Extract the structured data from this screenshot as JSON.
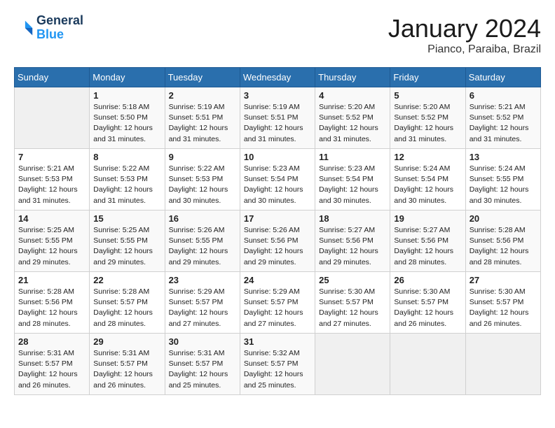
{
  "logo": {
    "line1": "General",
    "line2": "Blue"
  },
  "title": "January 2024",
  "location": "Pianco, Paraiba, Brazil",
  "days_of_week": [
    "Sunday",
    "Monday",
    "Tuesday",
    "Wednesday",
    "Thursday",
    "Friday",
    "Saturday"
  ],
  "weeks": [
    [
      {
        "day": "",
        "info": ""
      },
      {
        "day": "1",
        "info": "Sunrise: 5:18 AM\nSunset: 5:50 PM\nDaylight: 12 hours\nand 31 minutes."
      },
      {
        "day": "2",
        "info": "Sunrise: 5:19 AM\nSunset: 5:51 PM\nDaylight: 12 hours\nand 31 minutes."
      },
      {
        "day": "3",
        "info": "Sunrise: 5:19 AM\nSunset: 5:51 PM\nDaylight: 12 hours\nand 31 minutes."
      },
      {
        "day": "4",
        "info": "Sunrise: 5:20 AM\nSunset: 5:52 PM\nDaylight: 12 hours\nand 31 minutes."
      },
      {
        "day": "5",
        "info": "Sunrise: 5:20 AM\nSunset: 5:52 PM\nDaylight: 12 hours\nand 31 minutes."
      },
      {
        "day": "6",
        "info": "Sunrise: 5:21 AM\nSunset: 5:52 PM\nDaylight: 12 hours\nand 31 minutes."
      }
    ],
    [
      {
        "day": "7",
        "info": "Sunrise: 5:21 AM\nSunset: 5:53 PM\nDaylight: 12 hours\nand 31 minutes."
      },
      {
        "day": "8",
        "info": "Sunrise: 5:22 AM\nSunset: 5:53 PM\nDaylight: 12 hours\nand 31 minutes."
      },
      {
        "day": "9",
        "info": "Sunrise: 5:22 AM\nSunset: 5:53 PM\nDaylight: 12 hours\nand 30 minutes."
      },
      {
        "day": "10",
        "info": "Sunrise: 5:23 AM\nSunset: 5:54 PM\nDaylight: 12 hours\nand 30 minutes."
      },
      {
        "day": "11",
        "info": "Sunrise: 5:23 AM\nSunset: 5:54 PM\nDaylight: 12 hours\nand 30 minutes."
      },
      {
        "day": "12",
        "info": "Sunrise: 5:24 AM\nSunset: 5:54 PM\nDaylight: 12 hours\nand 30 minutes."
      },
      {
        "day": "13",
        "info": "Sunrise: 5:24 AM\nSunset: 5:55 PM\nDaylight: 12 hours\nand 30 minutes."
      }
    ],
    [
      {
        "day": "14",
        "info": "Sunrise: 5:25 AM\nSunset: 5:55 PM\nDaylight: 12 hours\nand 29 minutes."
      },
      {
        "day": "15",
        "info": "Sunrise: 5:25 AM\nSunset: 5:55 PM\nDaylight: 12 hours\nand 29 minutes."
      },
      {
        "day": "16",
        "info": "Sunrise: 5:26 AM\nSunset: 5:55 PM\nDaylight: 12 hours\nand 29 minutes."
      },
      {
        "day": "17",
        "info": "Sunrise: 5:26 AM\nSunset: 5:56 PM\nDaylight: 12 hours\nand 29 minutes."
      },
      {
        "day": "18",
        "info": "Sunrise: 5:27 AM\nSunset: 5:56 PM\nDaylight: 12 hours\nand 29 minutes."
      },
      {
        "day": "19",
        "info": "Sunrise: 5:27 AM\nSunset: 5:56 PM\nDaylight: 12 hours\nand 28 minutes."
      },
      {
        "day": "20",
        "info": "Sunrise: 5:28 AM\nSunset: 5:56 PM\nDaylight: 12 hours\nand 28 minutes."
      }
    ],
    [
      {
        "day": "21",
        "info": "Sunrise: 5:28 AM\nSunset: 5:56 PM\nDaylight: 12 hours\nand 28 minutes."
      },
      {
        "day": "22",
        "info": "Sunrise: 5:28 AM\nSunset: 5:57 PM\nDaylight: 12 hours\nand 28 minutes."
      },
      {
        "day": "23",
        "info": "Sunrise: 5:29 AM\nSunset: 5:57 PM\nDaylight: 12 hours\nand 27 minutes."
      },
      {
        "day": "24",
        "info": "Sunrise: 5:29 AM\nSunset: 5:57 PM\nDaylight: 12 hours\nand 27 minutes."
      },
      {
        "day": "25",
        "info": "Sunrise: 5:30 AM\nSunset: 5:57 PM\nDaylight: 12 hours\nand 27 minutes."
      },
      {
        "day": "26",
        "info": "Sunrise: 5:30 AM\nSunset: 5:57 PM\nDaylight: 12 hours\nand 26 minutes."
      },
      {
        "day": "27",
        "info": "Sunrise: 5:30 AM\nSunset: 5:57 PM\nDaylight: 12 hours\nand 26 minutes."
      }
    ],
    [
      {
        "day": "28",
        "info": "Sunrise: 5:31 AM\nSunset: 5:57 PM\nDaylight: 12 hours\nand 26 minutes."
      },
      {
        "day": "29",
        "info": "Sunrise: 5:31 AM\nSunset: 5:57 PM\nDaylight: 12 hours\nand 26 minutes."
      },
      {
        "day": "30",
        "info": "Sunrise: 5:31 AM\nSunset: 5:57 PM\nDaylight: 12 hours\nand 25 minutes."
      },
      {
        "day": "31",
        "info": "Sunrise: 5:32 AM\nSunset: 5:57 PM\nDaylight: 12 hours\nand 25 minutes."
      },
      {
        "day": "",
        "info": ""
      },
      {
        "day": "",
        "info": ""
      },
      {
        "day": "",
        "info": ""
      }
    ]
  ]
}
